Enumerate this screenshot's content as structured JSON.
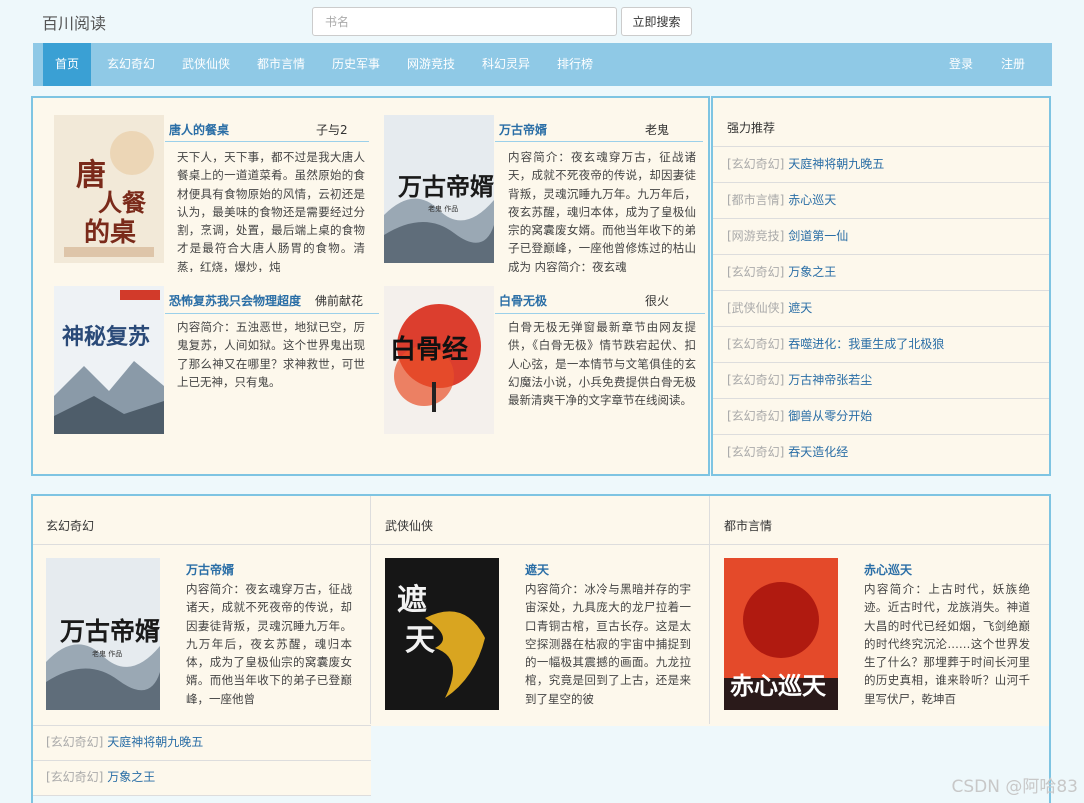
{
  "header": {
    "brand": "百川阅读",
    "search_placeholder": "书名",
    "search_button": "立即搜索"
  },
  "nav": {
    "items": [
      "首页",
      "玄幻奇幻",
      "武侠仙侠",
      "都市言情",
      "历史军事",
      "网游竞技",
      "科幻灵异",
      "排行榜"
    ],
    "login": "登录",
    "register": "注册"
  },
  "featured": [
    {
      "title": "唐人的餐桌",
      "author": "子与2",
      "desc": "天下人，天下事，都不过是我大唐人餐桌上的一道道菜肴。虽然原始的食材便具有食物原始的风情，云初还是认为，最美味的食物还是需要经过分割，烹调，处置，最后端上桌的食物才是最符合大唐人肠胃的食物。清蒸，红烧，爆炒，炖"
    },
    {
      "title": "万古帝婿",
      "author": "老鬼",
      "desc": "内容简介：夜玄魂穿万古，征战诸天，成就不死夜帝的传说，却因妻徒背叛，灵魂沉睡九万年。九万年后，夜玄苏醒，魂归本体，成为了皇极仙宗的窝囊废女婿。而他当年收下的弟子已登巅峰，一座他曾修炼过的枯山成为 内容简介：夜玄魂"
    },
    {
      "title": "恐怖复苏我只会物理超度",
      "author": "佛前献花",
      "desc": "内容简介：五浊恶世，地狱已空，厉鬼复苏，人间如狱。这个世界鬼出现了那么神又在哪里？求神救世，可世上已无神，只有鬼。"
    },
    {
      "title": "白骨无极",
      "author": "很火",
      "desc": "白骨无极无弹窗最新章节由网友提供，《白骨无极》情节跌宕起伏、扣人心弦，是一本情节与文笔俱佳的玄幻魔法小说，小兵免费提供白骨无极最新清爽干净的文字章节在线阅读。"
    }
  ],
  "recommend": {
    "heading": "强力推荐",
    "items": [
      {
        "tag": "[玄幻奇幻]",
        "title": "天庭神将朝九晚五"
      },
      {
        "tag": "[都市言情]",
        "title": "赤心巡天"
      },
      {
        "tag": "[网游竞技]",
        "title": "剑道第一仙"
      },
      {
        "tag": "[玄幻奇幻]",
        "title": "万象之王"
      },
      {
        "tag": "[武侠仙侠]",
        "title": "遮天"
      },
      {
        "tag": "[玄幻奇幻]",
        "title": "吞噬进化：我重生成了北极狼"
      },
      {
        "tag": "[玄幻奇幻]",
        "title": "万古神帝张若尘"
      },
      {
        "tag": "[玄幻奇幻]",
        "title": "御兽从零分开始"
      },
      {
        "tag": "[玄幻奇幻]",
        "title": "吞天造化经"
      }
    ]
  },
  "categories": [
    {
      "heading": "玄幻奇幻",
      "title": "万古帝婿",
      "desc": "内容简介：夜玄魂穿万古，征战诸天，成就不死夜帝的传说，却因妻徒背叛，灵魂沉睡九万年。九万年后，夜玄苏醒，魂归本体，成为了皇极仙宗的窝囊废女婿。而他当年收下的弟子已登巅峰，一座他曾"
    },
    {
      "heading": "武侠仙侠",
      "title": "遮天",
      "desc": "内容简介：冰冷与黑暗并存的宇宙深处，九具庞大的龙尸拉着一口青铜古棺，亘古长存。这是太空探测器在枯寂的宇宙中捕捉到的一幅极其震撼的画面。九龙拉棺，究竟是回到了上古，还是来到了星空的彼"
    },
    {
      "heading": "都市言情",
      "title": "赤心巡天",
      "desc": "内容简介：上古时代，妖族绝迹。近古时代，龙族消失。神道大昌的时代已经如烟，飞剑绝巅的时代终究沉沦……这个世界发生了什么？那埋葬于时间长河里的历史真相，谁来聆听？山河千里写伏尸，乾坤百"
    }
  ],
  "category_list": [
    {
      "tag": "[玄幻奇幻]",
      "title": "天庭神将朝九晚五"
    },
    {
      "tag": "[玄幻奇幻]",
      "title": "万象之王"
    }
  ],
  "watermark": "CSDN @阿哈83"
}
